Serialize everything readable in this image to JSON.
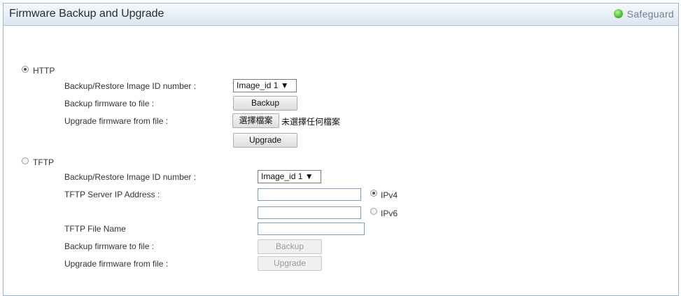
{
  "header": {
    "title": "Firmware Backup and Upgrade",
    "safeguard": "Safeguard"
  },
  "http": {
    "label": "HTTP",
    "image_id_label": "Backup/Restore Image ID number :",
    "image_id_value": "Image_id 1 ▼",
    "backup_label": "Backup firmware to file :",
    "backup_button": "Backup",
    "upgrade_label": "Upgrade firmware from file :",
    "choose_file_button": "選擇檔案",
    "no_file_text": "未選擇任何檔案",
    "upgrade_button": "Upgrade"
  },
  "tftp": {
    "label": "TFTP",
    "image_id_label": "Backup/Restore Image ID number :",
    "image_id_value": "Image_id 1 ▼",
    "server_ip_label": "TFTP Server IP Address :",
    "ipv4_label": "IPv4",
    "ipv6_label": "IPv6",
    "file_name_label": "TFTP File Name",
    "backup_label": "Backup firmware to file :",
    "backup_button": "Backup",
    "upgrade_label": "Upgrade firmware from file :",
    "upgrade_button": "Upgrade"
  },
  "colors": {
    "safeguard_dot": "#3cb11f",
    "header_text": "#1f2d3a"
  }
}
